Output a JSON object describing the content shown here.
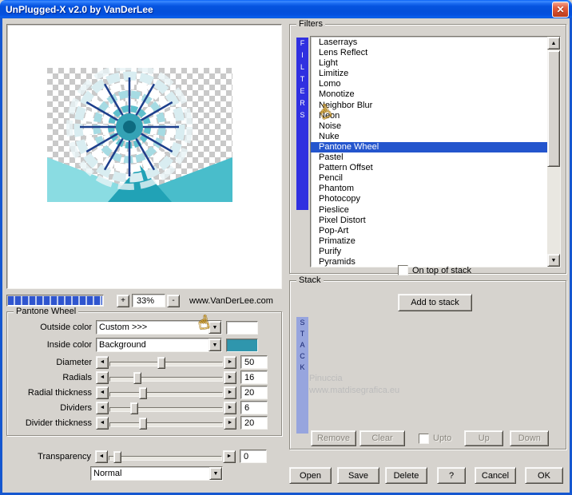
{
  "window": {
    "title": "UnPlugged-X v2.0 by VanDerLee",
    "close": "✕"
  },
  "preview": {
    "zoom_in": "+",
    "zoom_out": "-",
    "zoom_level": "33%",
    "website": "www.VanDerLee.com"
  },
  "pantone": {
    "title": "Pantone Wheel",
    "outside_color": {
      "label": "Outside color",
      "value": "Custom >>>",
      "swatch": "#ffffff"
    },
    "inside_color": {
      "label": "Inside color",
      "value": "Background",
      "swatch": "#2f96ad"
    },
    "sliders": [
      {
        "label": "Diameter",
        "value": "50",
        "pos": 42
      },
      {
        "label": "Radials",
        "value": "16",
        "pos": 21
      },
      {
        "label": "Radial thickness",
        "value": "20",
        "pos": 26
      },
      {
        "label": "Dividers",
        "value": "6",
        "pos": 18
      },
      {
        "label": "Divider thickness",
        "value": "20",
        "pos": 26
      }
    ],
    "transparency": {
      "label": "Transparency",
      "value": "0",
      "pos": 4
    },
    "blend_mode": "Normal"
  },
  "filters": {
    "title": "Filters",
    "vertical_label": "FILTERS",
    "items": [
      "Laserrays",
      "Lens Reflect",
      "Light",
      "Limitize",
      "Lomo",
      "Monotize",
      "Neighbor Blur",
      "Neon",
      "Noise",
      "Nuke",
      "Pantone Wheel",
      "Pastel",
      "Pattern Offset",
      "Pencil",
      "Phantom",
      "Photocopy",
      "Pieslice",
      "Pixel Distort",
      "Pop-Art",
      "Primatize",
      "Purify",
      "Pyramids"
    ],
    "selected": "Pantone Wheel",
    "on_top": {
      "label": "On top of stack",
      "checked": false
    }
  },
  "stack": {
    "title": "Stack",
    "add_button": "Add to stack",
    "vertical_label": "STACK",
    "watermark": [
      "Pinuccia",
      "www.matdisegrafica.eu"
    ],
    "remove": "Remove",
    "clear": "Clear",
    "upto": "Upto",
    "up": "Up",
    "down": "Down"
  },
  "footer": {
    "open": "Open",
    "save": "Save",
    "delete": "Delete",
    "help": "?",
    "cancel": "Cancel",
    "ok": "OK"
  },
  "glyphs": {
    "left_arrow": "◄",
    "right_arrow": "►",
    "up_arrow": "▲",
    "down_arrow": "▼"
  }
}
